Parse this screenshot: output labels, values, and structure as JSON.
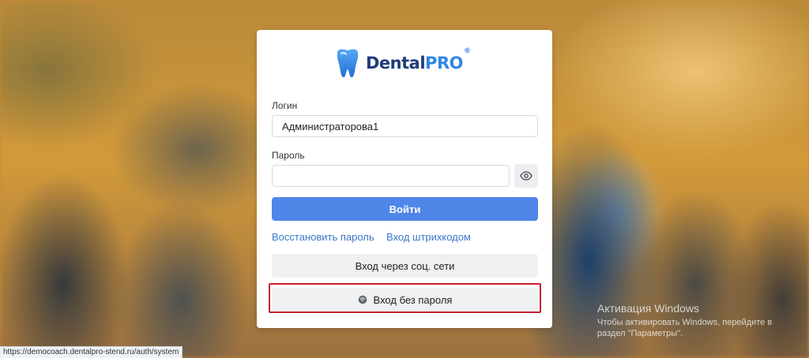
{
  "brand": {
    "name_part1": "Dental",
    "name_part2": "PRO",
    "reg_mark": "®",
    "tooth_icon": "tooth-icon",
    "color_dark": "#1f3c7a",
    "color_accent": "#2f87e6"
  },
  "login_form": {
    "login_label": "Логин",
    "login_value": "Администраторова1",
    "password_label": "Пароль",
    "password_value": "",
    "show_password_icon": "eye-icon",
    "submit_label": "Войти",
    "restore_link": "Восстановить пароль",
    "barcode_link": "Вход штрихкодом",
    "social_button": "Вход через соц. сети",
    "passwordless_button": "Вход без пароля",
    "passwordless_icon": "fingerprint-icon"
  },
  "status_bar": {
    "url": "https://democoach.dentalpro-stend.ru/auth/system"
  },
  "windows_activation": {
    "title": "Активация Windows",
    "line1": "Чтобы активировать Windows, перейдите в",
    "line2": "раздел \"Параметры\"."
  },
  "colors": {
    "primary_button": "#4f86e8",
    "link": "#3a78c8",
    "highlight_border": "#c8202a"
  }
}
